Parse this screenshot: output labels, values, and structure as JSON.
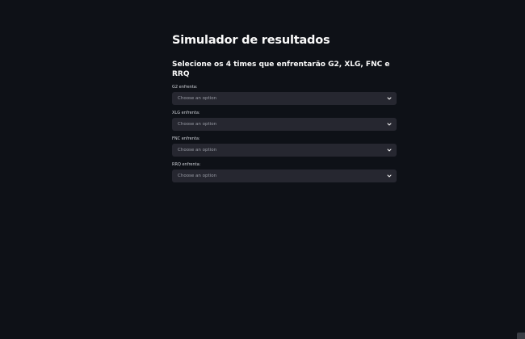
{
  "page": {
    "title": "Simulador de resultados",
    "subheader": "Selecione os 4 times que enfrentarão G2, XLG, FNC e RRQ"
  },
  "selects": [
    {
      "label": "G2 enfrenta:",
      "placeholder": "Choose an option"
    },
    {
      "label": "XLG enfrenta:",
      "placeholder": "Choose an option"
    },
    {
      "label": "FNC enfrenta:",
      "placeholder": "Choose an option"
    },
    {
      "label": "RRQ enfrenta:",
      "placeholder": "Choose an option"
    }
  ],
  "colors": {
    "background": "#0e1117",
    "select_background": "#262730",
    "text": "#fafafa"
  }
}
